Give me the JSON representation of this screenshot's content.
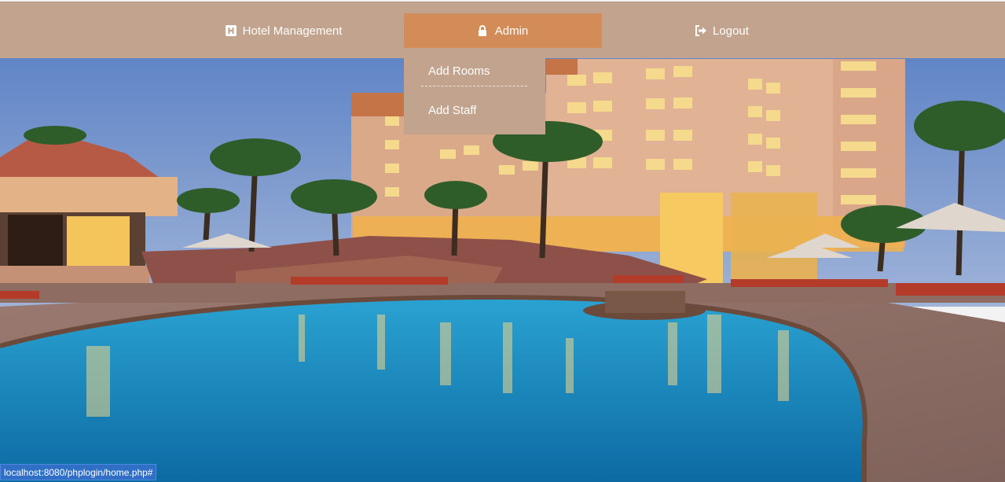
{
  "nav": {
    "hotel_label": "Hotel Management",
    "admin_label": "Admin",
    "logout_label": "Logout",
    "icons": {
      "hotel": "hotel-icon",
      "admin": "lock-icon",
      "logout": "sign-out-icon"
    }
  },
  "dropdown": {
    "items": [
      {
        "label": "Add Rooms"
      },
      {
        "label": "Add Staff"
      }
    ]
  },
  "status": {
    "url": "localhost:8080/phplogin/home.php#"
  },
  "colors": {
    "navbar": "#c2a38e",
    "active": "#d38c57",
    "pool": "#1f8fc2",
    "status": "#2f6fc6"
  }
}
